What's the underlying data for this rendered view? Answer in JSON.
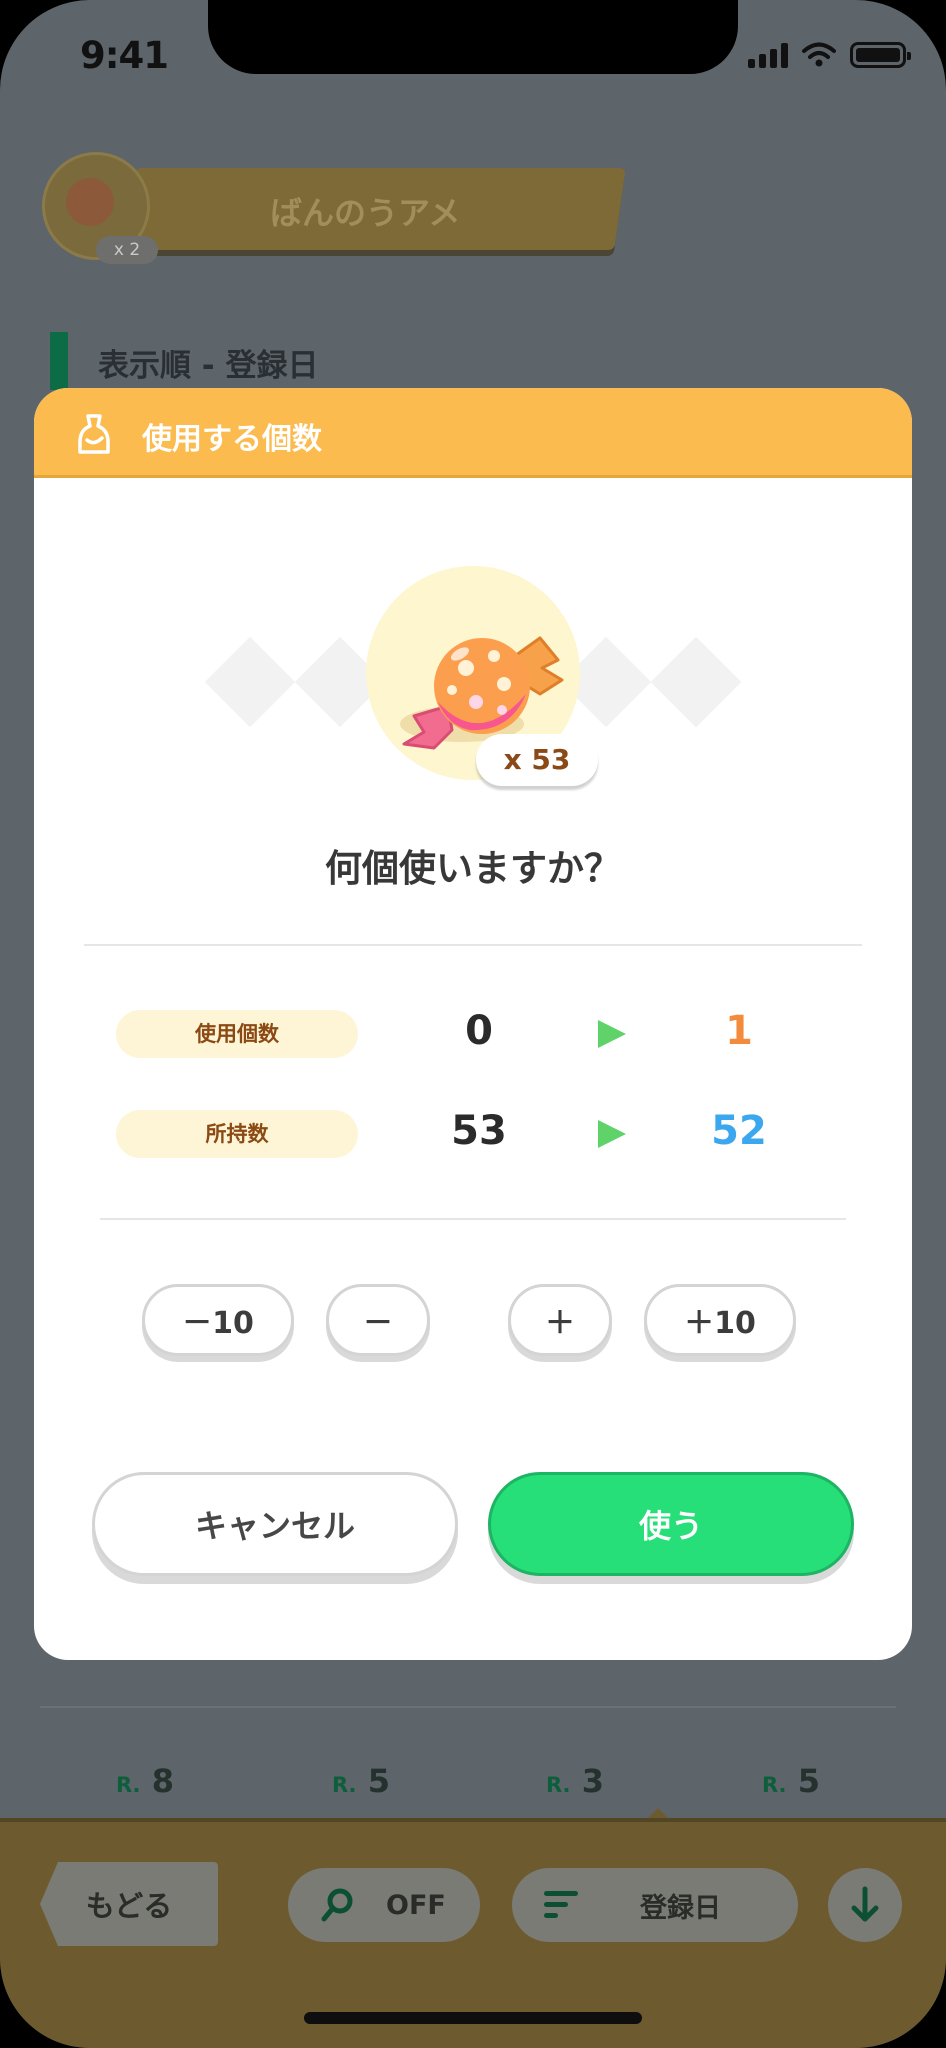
{
  "status_bar": {
    "time": "9:41"
  },
  "background": {
    "item_name": "ばんのうアメ",
    "item_badge": "x 2",
    "sort_label": "表示順 - 登録日",
    "ranks": [
      {
        "prefix": "R.",
        "value": "8"
      },
      {
        "prefix": "R.",
        "value": "5"
      },
      {
        "prefix": "R.",
        "value": "3"
      },
      {
        "prefix": "R.",
        "value": "5"
      }
    ]
  },
  "toolbar": {
    "back_label": "もどる",
    "search_label": "OFF",
    "sort_label": "登録日"
  },
  "modal": {
    "title": "使用する個数",
    "owned_badge": "x 53",
    "question": "何個使いますか？",
    "rows": [
      {
        "label": "使用個数",
        "from": "0",
        "to": "1"
      },
      {
        "label": "所持数",
        "from": "53",
        "to": "52"
      }
    ],
    "steppers": {
      "minus10": "－10",
      "minus1": "－",
      "plus1": "＋",
      "plus10": "＋10"
    },
    "cancel_label": "キャンセル",
    "use_label": "使う"
  },
  "colors": {
    "header": "#fbbb4e",
    "use_button": "#26df78",
    "to_use": "#f28b3c",
    "to_owned": "#3ba7ee",
    "arrow": "#5fd36a"
  },
  "icons": [
    "signal-icon",
    "wifi-icon",
    "battery-icon",
    "candy-icon",
    "pokemon-silhouette-icon",
    "search-icon",
    "sort-lines-icon",
    "arrow-down-icon"
  ]
}
